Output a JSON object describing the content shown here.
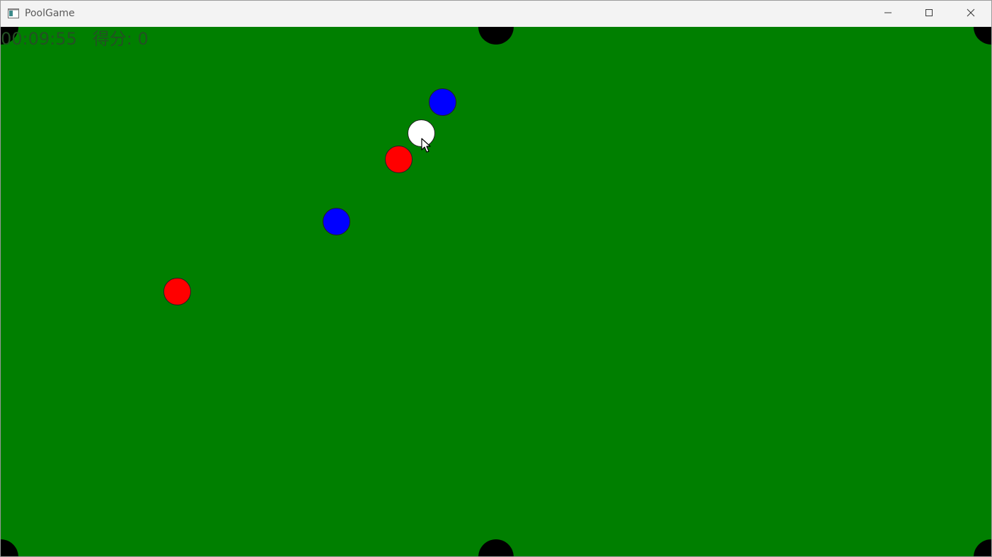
{
  "window": {
    "title": "PoolGame",
    "icon": "app-window-icon",
    "controls": {
      "minimize_icon": "minimize-icon",
      "maximize_icon": "maximize-icon",
      "close_icon": "close-icon"
    }
  },
  "hud": {
    "time": "00:09:55",
    "score_label": "得分: 0"
  },
  "table": {
    "felt_color": "#007f00",
    "pocket_color": "#000000"
  },
  "balls": [
    {
      "name": "cue-ball",
      "color": "#ffffff"
    },
    {
      "name": "blue-ball",
      "color": "#0000ff"
    },
    {
      "name": "blue-ball",
      "color": "#0000ff"
    },
    {
      "name": "red-ball",
      "color": "#ff0000"
    },
    {
      "name": "red-ball",
      "color": "#ff0000"
    }
  ],
  "cursor": {
    "icon": "mouse-pointer-icon"
  }
}
